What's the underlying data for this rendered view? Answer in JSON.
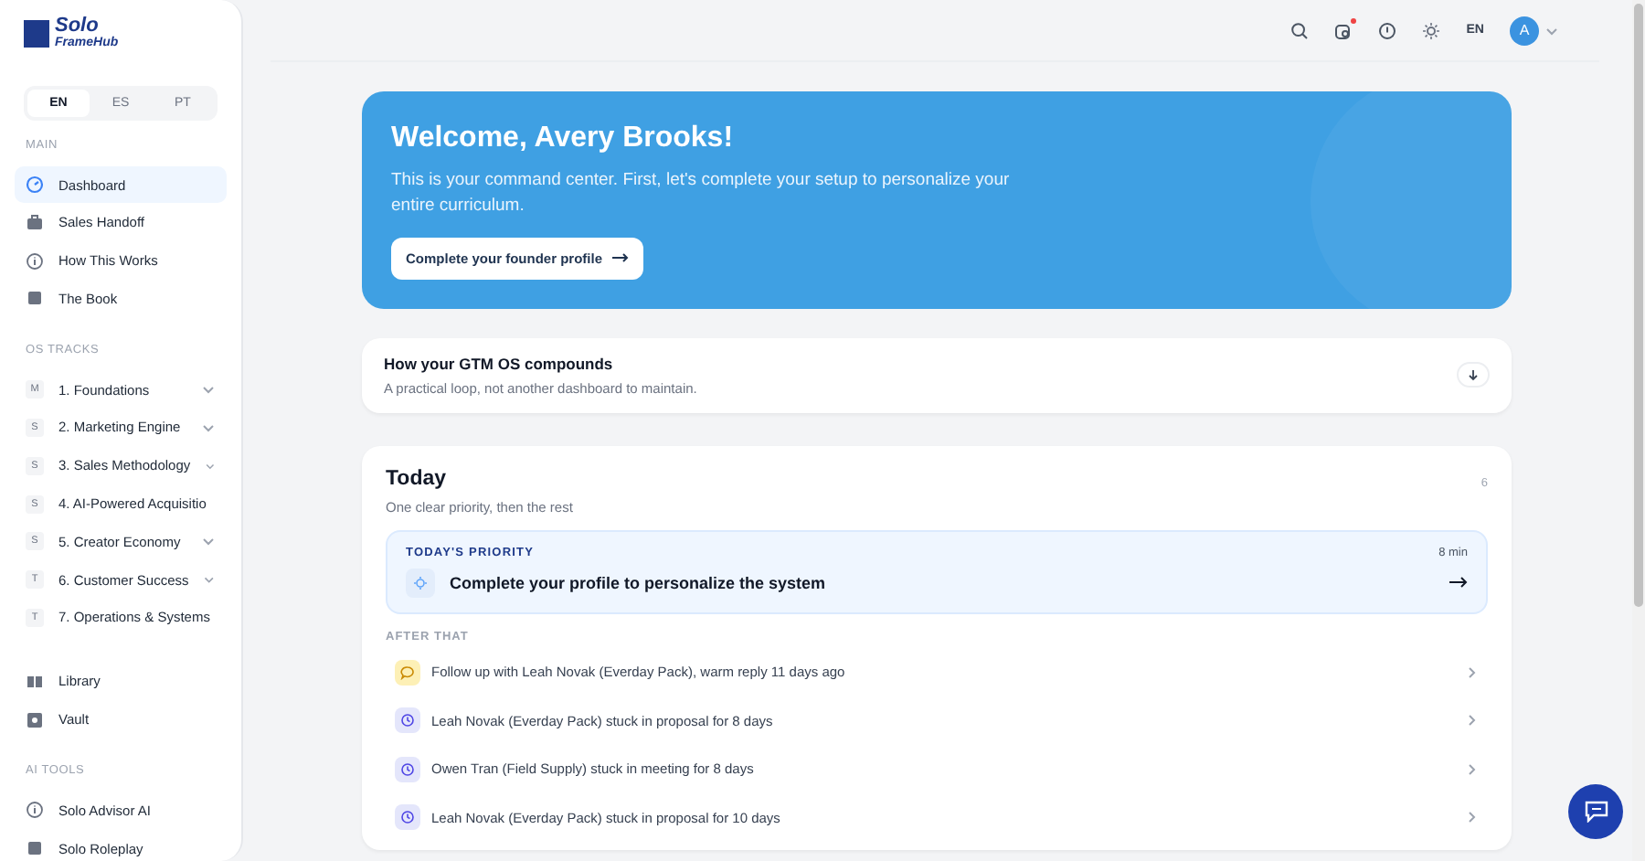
{
  "brand": {
    "line1": "Solo",
    "line2": "FrameHub"
  },
  "languages": [
    {
      "label": "EN",
      "selected": true
    },
    {
      "label": "ES",
      "selected": false
    },
    {
      "label": "PT",
      "selected": false
    }
  ],
  "sidebar": {
    "sections": [
      {
        "title": "MAIN",
        "items": [
          {
            "label": "Dashboard",
            "kind": "dashboard",
            "selected": true
          },
          {
            "label": "Sales Handoff",
            "kind": "briefcase",
            "selected": false
          },
          {
            "label": "How This Works",
            "kind": "info",
            "selected": false
          },
          {
            "label": "The Book",
            "kind": "book",
            "selected": false
          }
        ]
      },
      {
        "title": "OS TRACKS",
        "items": [
          {
            "label": "1. Foundations",
            "kind": "track",
            "badge": "M",
            "collapsible": true,
            "selected": false
          },
          {
            "label": "2. Marketing Engine",
            "kind": "track",
            "badge": "S",
            "collapsible": true,
            "selected": false
          },
          {
            "label": "3. Sales Methodology",
            "kind": "track",
            "badge": "S",
            "collapsible": true,
            "selected": false
          },
          {
            "label": "4. AI-Powered Acquisitio",
            "kind": "track",
            "badge": "S",
            "selected": false
          },
          {
            "label": "5. Creator Economy",
            "kind": "track",
            "badge": "S",
            "collapsible": true,
            "selected": false
          },
          {
            "label": "6. Customer Success",
            "kind": "track",
            "badge": "T",
            "collapsible": true,
            "selected": false
          },
          {
            "label": "7. Operations & Systems",
            "kind": "track",
            "badge": "T",
            "selected": false
          }
        ]
      },
      {
        "items": [
          {
            "label": "Library",
            "kind": "library",
            "selected": false
          },
          {
            "label": "Vault",
            "kind": "vault",
            "selected": false
          }
        ]
      },
      {
        "title": "AI TOOLS",
        "items": [
          {
            "label": "Solo Advisor AI",
            "kind": "info",
            "selected": false
          },
          {
            "label": "Solo Roleplay",
            "kind": "book",
            "selected": false
          }
        ]
      }
    ]
  },
  "topbar": {
    "notification": true,
    "language": "EN",
    "avatar": "A"
  },
  "hero": {
    "title": "Welcome, Avery Brooks!",
    "text": "This is your command center. First, let's complete your setup to personalize your entire curriculum.",
    "button": "Complete your founder profile"
  },
  "compounds": {
    "title": "How your GTM OS compounds",
    "subtitle": "A practical loop, not another dashboard to maintain."
  },
  "today": {
    "title": "Today",
    "subtitle": "One clear priority, then the rest",
    "count": "6",
    "priority": {
      "label": "TODAY'S PRIORITY",
      "time": "8 min",
      "text": "Complete your profile to personalize the system"
    },
    "after_label": "AFTER THAT",
    "tasks": [
      {
        "kind": "message",
        "text": "Follow up with Leah Novak (Everday Pack), warm reply 11 days ago"
      },
      {
        "kind": "stuck",
        "text": "Leah Novak (Everday Pack) stuck in proposal for 8 days"
      },
      {
        "kind": "stuck",
        "text": "Owen Tran (Field Supply) stuck in meeting for 8 days"
      },
      {
        "kind": "stuck",
        "text": "Leah Novak (Everday Pack) stuck in proposal for 10 days"
      }
    ]
  }
}
